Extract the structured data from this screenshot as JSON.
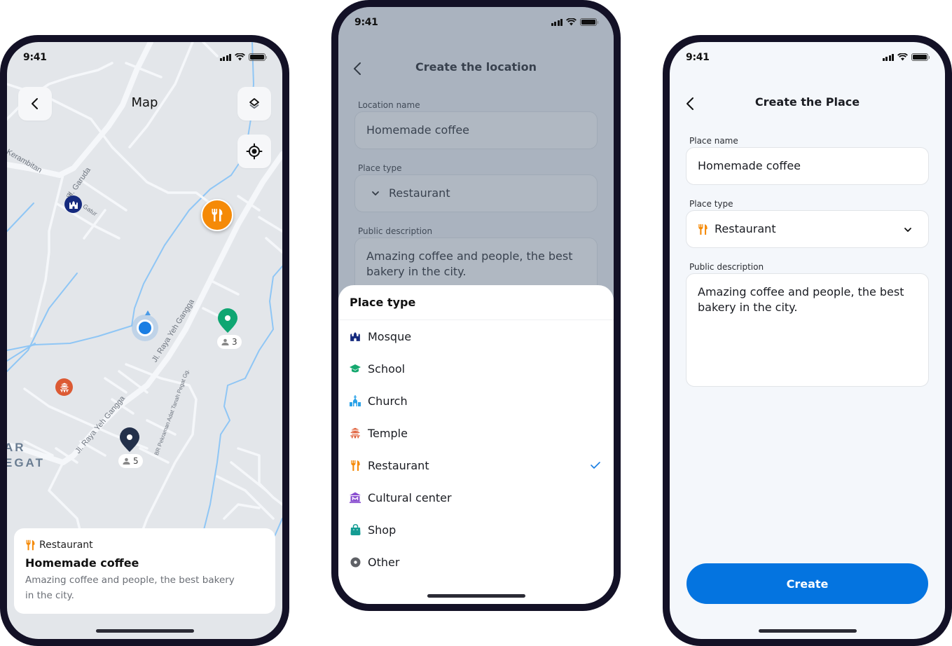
{
  "status_bar": {
    "time": "9:41"
  },
  "map_screen": {
    "title": "Map",
    "street_labels": [
      "Kerambitan",
      "Jl. Garuda",
      "Jl. Gn. Gatur",
      "Jl. Raya Yeh Gangga",
      "Jl. Raya Yeh Gangga",
      "BR Pekraman Adat Tanah Pegat Gg."
    ],
    "area_label_lines": [
      "AR",
      "EGAT"
    ],
    "markers": [
      {
        "type": "mosque",
        "color": "#152a7e"
      },
      {
        "type": "restaurant",
        "color": "#f58a07"
      },
      {
        "type": "temple",
        "color": "#dc5a34"
      },
      {
        "type": "user-location",
        "color": "#1a7ee3"
      },
      {
        "type": "pin",
        "color": "#0fa672",
        "count": "3"
      },
      {
        "type": "pin",
        "color": "#23304a",
        "count": "5"
      }
    ],
    "card": {
      "type_label": "Restaurant",
      "name": "Homemade coffee",
      "description": "Amazing coffee and people, the best bakery in the city."
    }
  },
  "location_screen": {
    "title": "Create the location",
    "fields": {
      "name_label": "Location name",
      "name_value": "Homemade coffee",
      "type_label": "Place type",
      "type_value": "Restaurant",
      "description_label": "Public description",
      "description_value": "Amazing coffee and people, the best bakery in the city."
    },
    "sheet": {
      "title": "Place type",
      "selected": "Restaurant",
      "options": [
        {
          "label": "Mosque",
          "icon": "mosque-icon",
          "color": "#152a7e"
        },
        {
          "label": "School",
          "icon": "graduation-cap-icon",
          "color": "#16a86f"
        },
        {
          "label": "Church",
          "icon": "church-icon",
          "color": "#2aa2e8"
        },
        {
          "label": "Temple",
          "icon": "temple-icon",
          "color": "#e0603a"
        },
        {
          "label": "Restaurant",
          "icon": "fork-knife-icon",
          "color": "#f58a07"
        },
        {
          "label": "Cultural center",
          "icon": "museum-icon",
          "color": "#8a4fd0"
        },
        {
          "label": "Shop",
          "icon": "shopping-bag-icon",
          "color": "#149c93"
        },
        {
          "label": "Other",
          "icon": "circle-dot-icon",
          "color": "#5f6166"
        }
      ]
    }
  },
  "place_screen": {
    "title": "Create the Place",
    "fields": {
      "name_label": "Place name",
      "name_value": "Homemade coffee",
      "type_label": "Place type",
      "type_value": "Restaurant",
      "description_label": "Public description",
      "description_value": "Amazing coffee and people, the best bakery in the city."
    },
    "create_label": "Create"
  },
  "colors": {
    "primary": "#0474e0",
    "restaurant": "#f58a07",
    "check": "#1a7ee3"
  }
}
